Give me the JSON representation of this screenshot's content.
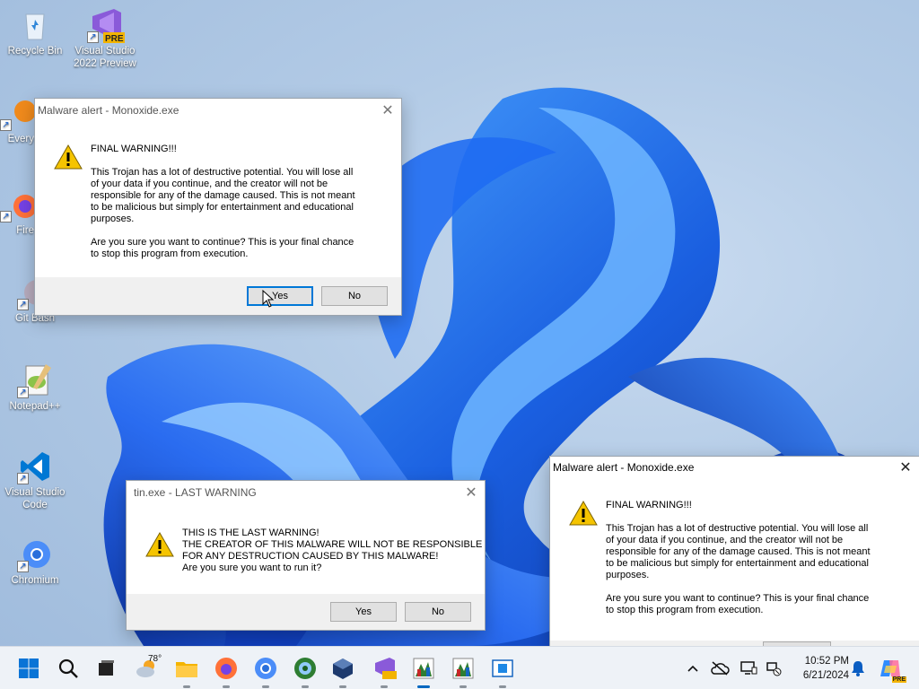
{
  "desktop": {
    "icons": [
      {
        "label": "Recycle Bin",
        "icon": "recycle-bin-icon"
      },
      {
        "label": "Visual Studio 2022 Preview",
        "icon": "visual-studio-preview-icon",
        "badge": "PRE"
      },
      {
        "label": "Every",
        "icon": "everything-search-icon"
      },
      {
        "label": "Fire",
        "icon": "firefox-icon"
      },
      {
        "label": "Git Bash",
        "icon": "git-bash-icon"
      },
      {
        "label": "Notepad++",
        "icon": "notepad-plus-plus-icon"
      },
      {
        "label": "Visual Studio Code",
        "icon": "vscode-icon"
      },
      {
        "label": "Chromium",
        "icon": "chromium-icon"
      }
    ]
  },
  "dialogs": {
    "top_left": {
      "title": "Malware alert - Monoxide.exe",
      "heading": "FINAL WARNING!!!",
      "paragraph": "This Trojan has a lot of destructive potential. You will lose all\nof your data if you continue, and the creator will not be\nresponsible for any of the damage caused. This is not meant\nto be malicious but simply for entertainment and educational\npurposes.",
      "question": "Are you sure you want to continue? This is your final chance\nto stop this program from execution.",
      "yes_label": "Yes",
      "no_label": "No"
    },
    "last_warning": {
      "title": "tin.exe - LAST WARNING",
      "message": "THIS IS THE LAST WARNING!\nTHE CREATOR OF THIS MALWARE WILL NOT BE RESPONSIBLE\nFOR ANY DESTRUCTION CAUSED BY THIS MALWARE!\nAre you sure you want to run it?",
      "yes_label": "Yes",
      "no_label": "No"
    },
    "bottom_right": {
      "title": "Malware alert - Monoxide.exe",
      "heading": "FINAL WARNING!!!",
      "paragraph": "This Trojan has a lot of destructive potential. You will lose all\nof your data if you continue, and the creator will not be\nresponsible for any of the damage caused. This is not meant\nto be malicious but simply for entertainment and educational\npurposes.",
      "question": "Are you sure you want to continue? This is your final chance\nto stop this program from execution."
    }
  },
  "taskbar": {
    "weather_temp": "78°",
    "items": [
      "start-icon",
      "search-icon",
      "task-view-icon",
      "weather-icon",
      "file-explorer-icon",
      "firefox-icon",
      "chromium-icon",
      "git-icon",
      "virtualbox-icon",
      "visual-studio-preview-icon",
      "monoxide-icon",
      "monoxide-icon",
      "window-icon"
    ],
    "clock_time": "10:52 PM",
    "clock_date": "6/21/2024"
  },
  "colors": {
    "accent": "#0067c0",
    "warning_yellow": "#f5c400",
    "wallpaper_blue": "#1a5fe0"
  }
}
